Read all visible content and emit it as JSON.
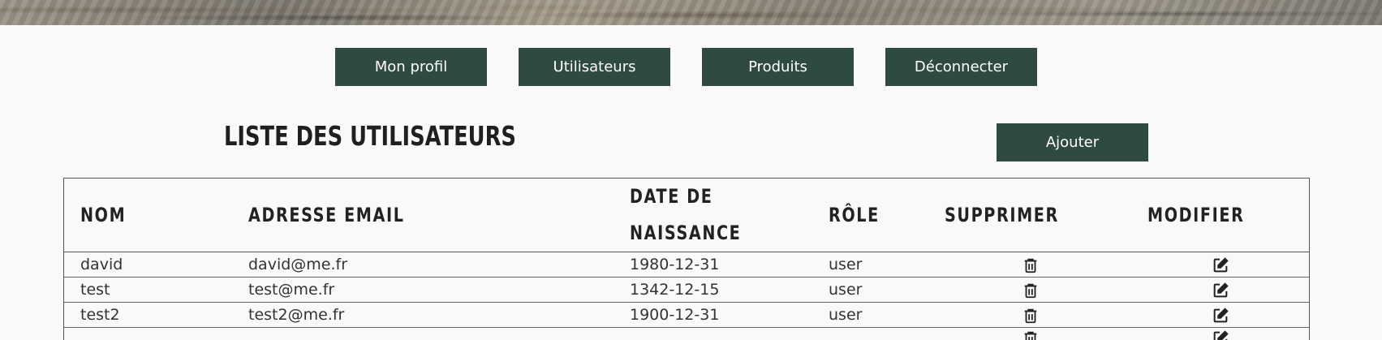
{
  "nav": {
    "items": [
      {
        "label": "Mon profil"
      },
      {
        "label": "Utilisateurs"
      },
      {
        "label": "Produits"
      },
      {
        "label": "Déconnecter"
      }
    ]
  },
  "page": {
    "title": "LISTE DES UTILISATEURS",
    "add_label": "Ajouter"
  },
  "table": {
    "headers": {
      "name": "NOM",
      "email": "ADRESSE EMAIL",
      "birth_line1": "DATE DE",
      "birth_line2": "NAISSANCE",
      "role": "RÔLE",
      "delete": "SUPPRIMER",
      "edit": "MODIFIER"
    },
    "rows": [
      {
        "name": "david",
        "email": "david@me.fr",
        "birth": "1980-12-31",
        "role": "user"
      },
      {
        "name": "test",
        "email": "test@me.fr",
        "birth": "1342-12-15",
        "role": "user"
      },
      {
        "name": "test2",
        "email": "test2@me.fr",
        "birth": "1900-12-31",
        "role": "user"
      }
    ],
    "icons": {
      "delete": "trash-icon",
      "edit": "edit-icon"
    }
  },
  "colors": {
    "button_bg": "#2f4a3f",
    "button_text": "#ffffff",
    "page_bg": "#f9f9f9"
  }
}
